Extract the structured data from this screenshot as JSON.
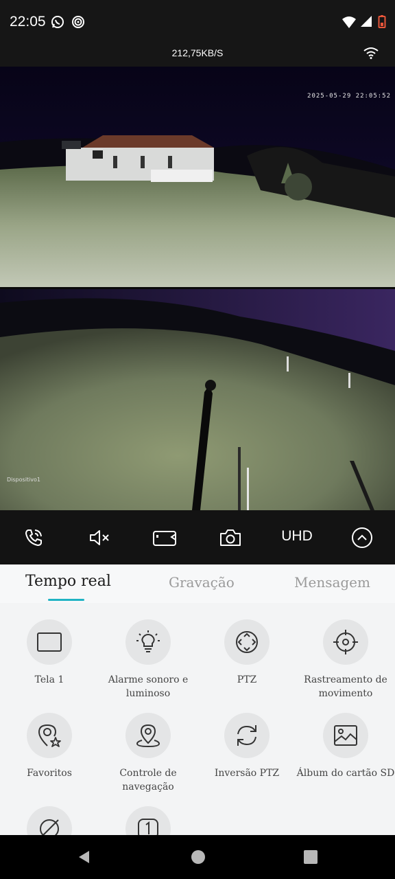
{
  "status_bar": {
    "time": "22:05",
    "battery_color": "#e8563a"
  },
  "network": {
    "speed": "212,75KB/S"
  },
  "video": {
    "camera1_timestamp": "2025-05-29 22:05:52",
    "camera2_device_label": "Dispositivo1"
  },
  "controls": {
    "quality_label": "UHD"
  },
  "tabs": [
    {
      "label": "Tempo real",
      "active": true
    },
    {
      "label": "Gravação",
      "active": false
    },
    {
      "label": "Mensagem",
      "active": false
    }
  ],
  "accent_color": "#1fb3c4",
  "features": [
    {
      "label": "Tela 1",
      "icon": "screen-icon"
    },
    {
      "label": "Alarme sonoro e luminoso",
      "icon": "light-bulb-icon"
    },
    {
      "label": "PTZ",
      "icon": "ptz-arrows-icon"
    },
    {
      "label": "Rastreamento de movimento",
      "icon": "crosshair-icon"
    },
    {
      "label": "Favoritos",
      "icon": "favorite-location-icon"
    },
    {
      "label": "Controle de navegação",
      "icon": "navigation-pin-icon"
    },
    {
      "label": "Inversão PTZ",
      "icon": "rotate-icon"
    },
    {
      "label": "Álbum do cartão SD",
      "icon": "album-image-icon"
    },
    {
      "label": "",
      "icon": "no-location-icon"
    },
    {
      "label": "",
      "icon": "numbered-tag-icon"
    }
  ]
}
